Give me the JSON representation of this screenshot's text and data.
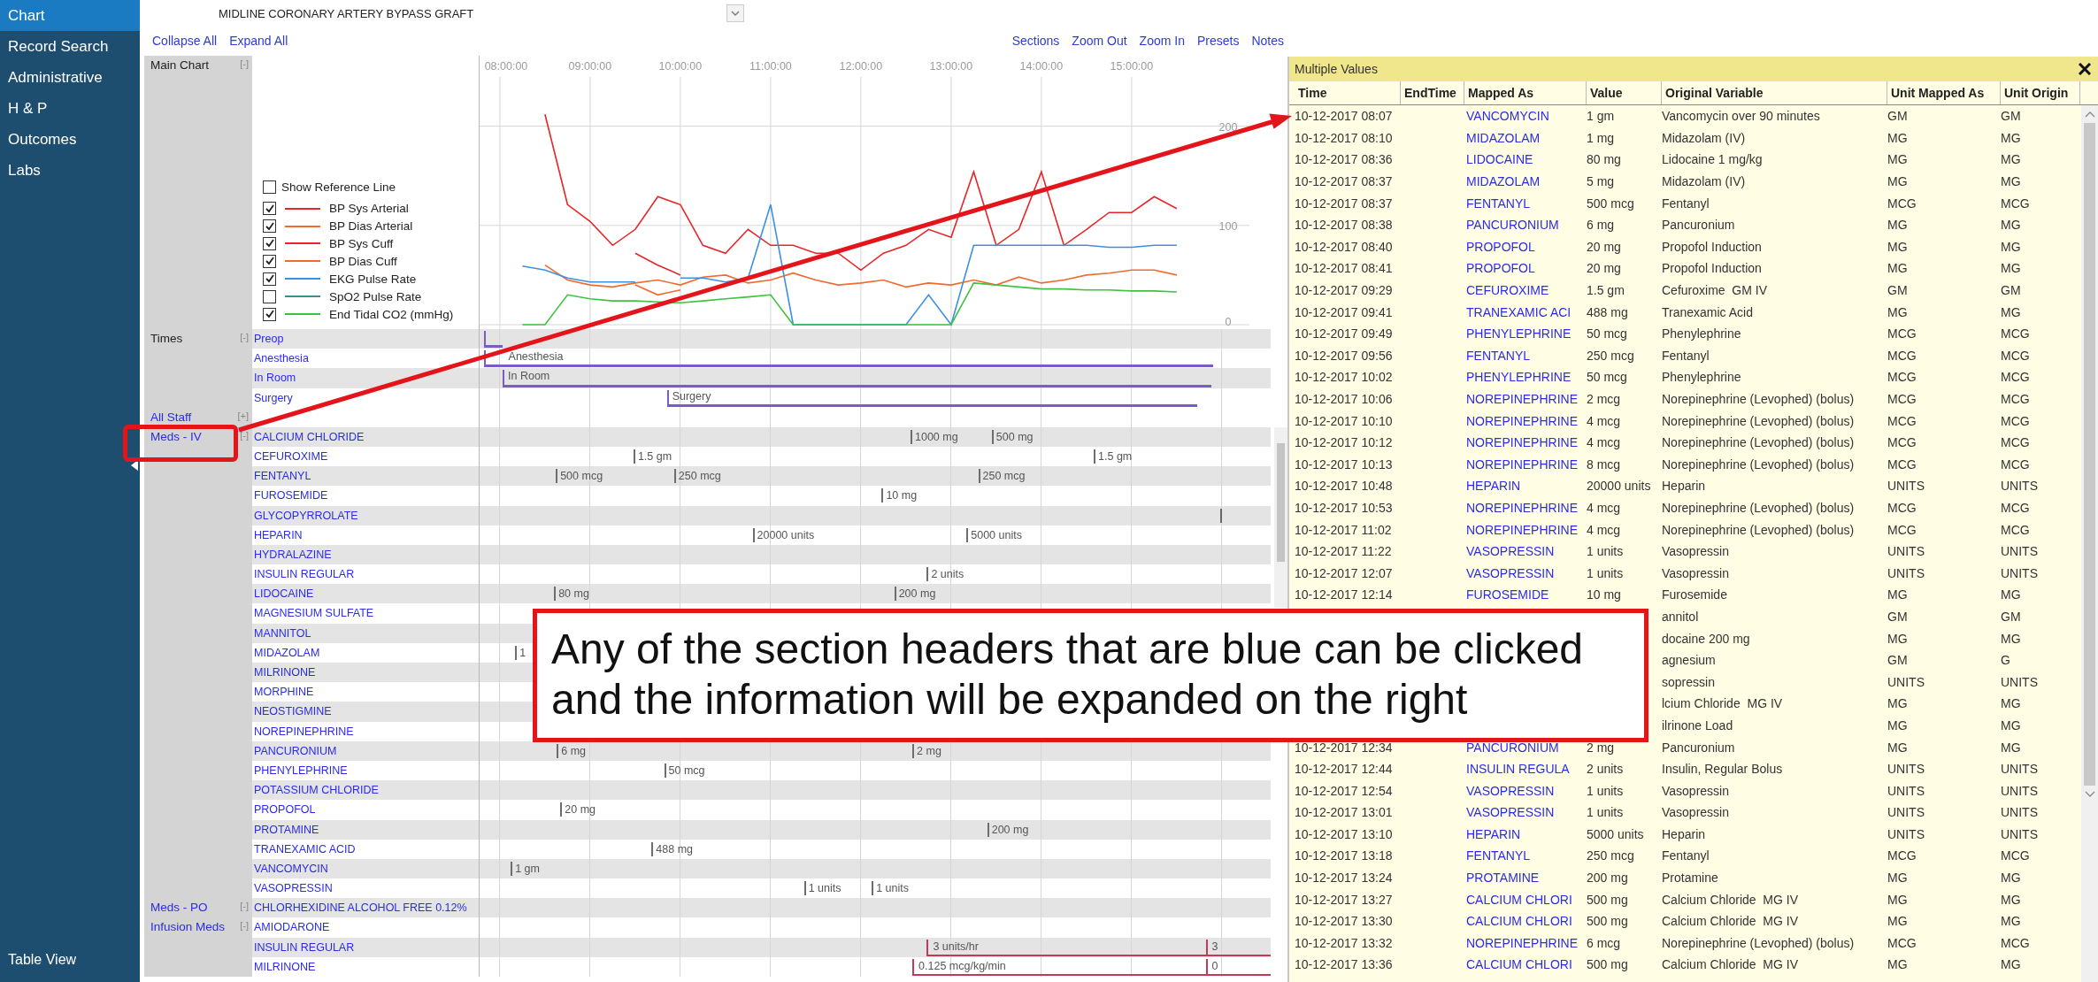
{
  "sidebar": {
    "items": [
      {
        "label": "Chart",
        "selected": true
      },
      {
        "label": "Record Search",
        "selected": false
      },
      {
        "label": "Administrative",
        "selected": false
      },
      {
        "label": "H & P",
        "selected": false
      },
      {
        "label": "Outcomes",
        "selected": false
      },
      {
        "label": "Labs",
        "selected": false
      }
    ],
    "footer": "Table View"
  },
  "procedure": "MIDLINE CORONARY ARTERY BYPASS GRAFT",
  "toolbar": {
    "left": [
      "Collapse All",
      "Expand All"
    ],
    "right": [
      "Sections",
      "Zoom Out",
      "Zoom In",
      "Presets",
      "Notes"
    ]
  },
  "main_chart": {
    "label": "Main Chart",
    "toggle": "[-]",
    "show_reference_line": {
      "label": "Show Reference Line",
      "checked": false
    },
    "legend": [
      {
        "checked": true
      },
      {
        "checked": true
      },
      {
        "checked": true
      },
      {
        "checked": true
      },
      {
        "checked": true
      },
      {
        "checked": false
      },
      {
        "checked": true
      }
    ],
    "chart_data": {
      "type": "line",
      "grid": true,
      "xlim": [
        7.775,
        16.55
      ],
      "ylim": [
        0,
        271
      ],
      "x": [
        8.25,
        8.5,
        8.75,
        9,
        9.25,
        9.5,
        9.75,
        10,
        10.25,
        10.5,
        10.75,
        11,
        11.25,
        11.5,
        11.75,
        12,
        12.25,
        12.5,
        12.75,
        13,
        13.25,
        13.5,
        13.75,
        14,
        14.25,
        14.5,
        14.75,
        15,
        15.25,
        15.5
      ],
      "xticks": [
        {
          "value": 8,
          "label": "08:00:00"
        },
        {
          "value": 9,
          "label": "09:00:00"
        },
        {
          "value": 10,
          "label": "10:00:00"
        },
        {
          "value": 11,
          "label": "11:00:00"
        },
        {
          "value": 12,
          "label": "12:00:00"
        },
        {
          "value": 13,
          "label": "13:00:00"
        },
        {
          "value": 14,
          "label": "14:00:00"
        },
        {
          "value": 15,
          "label": "15:00:00"
        }
      ],
      "yticks": [
        0,
        100,
        200
      ],
      "series": [
        {
          "name": "BP Sys Arterial",
          "color": "#e8262a",
          "values": [
            null,
            212,
            121,
            104,
            80,
            96,
            129,
            121,
            80,
            72,
            96,
            80,
            80,
            72,
            72,
            55,
            72,
            80,
            96,
            88,
            154,
            80,
            96,
            154,
            80,
            96,
            113,
            113,
            129,
            117
          ]
        },
        {
          "name": "BP Dias Arterial",
          "color": "#f26a2e",
          "values": [
            null,
            60,
            45,
            40,
            38,
            42,
            45,
            40,
            48,
            50,
            42,
            45,
            52,
            45,
            40,
            42,
            45,
            38,
            42,
            40,
            45,
            40,
            48,
            42,
            45,
            50,
            52,
            55,
            55,
            50
          ]
        },
        {
          "name": "BP Sys Cuff",
          "color": "#e8262a",
          "values": [
            null,
            null,
            null,
            null,
            null,
            72,
            60,
            50,
            null,
            null,
            null,
            null,
            null,
            null,
            null,
            null,
            null,
            null,
            null,
            null,
            null,
            null,
            null,
            null,
            null,
            null,
            null,
            null,
            null,
            null
          ]
        },
        {
          "name": "BP Dias Cuff",
          "color": "#f26a2e",
          "values": [
            null,
            null,
            null,
            null,
            null,
            40,
            30,
            35,
            null,
            null,
            null,
            null,
            null,
            null,
            null,
            null,
            null,
            null,
            null,
            null,
            null,
            null,
            null,
            null,
            null,
            null,
            null,
            null,
            null,
            null
          ]
        },
        {
          "name": "EKG Pulse Rate",
          "color": "#3d8fe6",
          "values": [
            59,
            55,
            47,
            43,
            43,
            43,
            null,
            47,
            47,
            43,
            47,
            121,
            0,
            0,
            0,
            0,
            0,
            0,
            30,
            0,
            80,
            80,
            80,
            80,
            80,
            80,
            78,
            78,
            80,
            80
          ]
        },
        {
          "name": "SpO2 Pulse Rate",
          "color": "#3c8f8f",
          "values": [
            null,
            null,
            null,
            null,
            null,
            null,
            null,
            null,
            null,
            null,
            null,
            null,
            null,
            null,
            null,
            null,
            null,
            null,
            null,
            null,
            null,
            null,
            null,
            null,
            null,
            null,
            null,
            null,
            null,
            null
          ]
        },
        {
          "name": "End Tidal CO2 (mmHg)",
          "color": "#3fc23f",
          "values": [
            0,
            0,
            30,
            26,
            24,
            24,
            23,
            22,
            24,
            26,
            28,
            30,
            0,
            0,
            0,
            0,
            0,
            0,
            0,
            0,
            42,
            40,
            38,
            36,
            36,
            35,
            35,
            34,
            34,
            33
          ]
        }
      ]
    }
  },
  "sections": [
    {
      "label": "Times",
      "toggle": "[-]",
      "clickable": false,
      "rows": [
        {
          "name": "Preop",
          "items": [
            {
              "kind": "bar"
            }
          ]
        },
        {
          "name": "Anesthesia",
          "items": [
            {
              "kind": "bar",
              "label": "Anesthesia"
            }
          ]
        },
        {
          "name": "In Room",
          "items": [
            {
              "kind": "bar",
              "label": "In Room"
            }
          ]
        },
        {
          "name": "Surgery",
          "items": [
            {
              "kind": "bar",
              "label": "Surgery"
            }
          ]
        }
      ]
    },
    {
      "label": "All Staff",
      "toggle": "[+]",
      "clickable": true
    },
    {
      "label": "Meds - IV",
      "toggle": "[-]",
      "clickable": true,
      "rows": [
        {
          "name": "CALCIUM CHLORIDE",
          "items": [
            {
              "kind": "dose",
              "label": "1000 mg"
            },
            {
              "kind": "dose",
              "label": "500 mg"
            }
          ]
        },
        {
          "name": "CEFUROXIME",
          "items": [
            {
              "kind": "dose",
              "label": "1.5 gm"
            },
            {
              "kind": "dose",
              "label": "1.5 gm"
            }
          ]
        },
        {
          "name": "FENTANYL",
          "items": [
            {
              "kind": "dose",
              "label": "500 mcg"
            },
            {
              "kind": "dose",
              "label": "250 mcg"
            },
            {
              "kind": "dose",
              "label": "250 mcg"
            }
          ]
        },
        {
          "name": "FUROSEMIDE",
          "items": [
            {
              "kind": "dose",
              "label": "10 mg"
            }
          ]
        },
        {
          "name": "GLYCOPYRROLATE",
          "items": [
            {
              "kind": "tick"
            }
          ]
        },
        {
          "name": "HEPARIN",
          "items": [
            {
              "kind": "dose",
              "label": "20000 units"
            },
            {
              "kind": "dose",
              "label": "5000 units"
            }
          ]
        },
        {
          "name": "HYDRALAZINE"
        },
        {
          "name": "INSULIN REGULAR",
          "items": [
            {
              "kind": "dose",
              "label": "2 units"
            }
          ]
        },
        {
          "name": "LIDOCAINE",
          "items": [
            {
              "kind": "dose",
              "label": "80 mg"
            },
            {
              "kind": "dose",
              "label": "200 mg"
            }
          ]
        },
        {
          "name": "MAGNESIUM SULFATE"
        },
        {
          "name": "MANNITOL"
        },
        {
          "name": "MIDAZOLAM",
          "items": [
            {
              "kind": "dose",
              "label": "1"
            }
          ]
        },
        {
          "name": "MILRINONE"
        },
        {
          "name": "MORPHINE"
        },
        {
          "name": "NEOSTIGMINE"
        },
        {
          "name": "NOREPINEPHRINE"
        },
        {
          "name": "PANCURONIUM",
          "items": [
            {
              "kind": "dose",
              "label": "6 mg"
            },
            {
              "kind": "dose",
              "label": "2 mg"
            }
          ]
        },
        {
          "name": "PHENYLEPHRINE",
          "items": [
            {
              "kind": "dose",
              "label": "50 mcg"
            }
          ]
        },
        {
          "name": "POTASSIUM CHLORIDE"
        },
        {
          "name": "PROPOFOL",
          "items": [
            {
              "kind": "dose",
              "label": "20 mg"
            }
          ]
        },
        {
          "name": "PROTAMINE",
          "items": [
            {
              "kind": "dose",
              "label": "200 mg"
            }
          ]
        },
        {
          "name": "TRANEXAMIC ACID",
          "items": [
            {
              "kind": "dose",
              "label": "488 mg"
            }
          ]
        },
        {
          "name": "VANCOMYCIN",
          "items": [
            {
              "kind": "dose",
              "label": "1 gm"
            }
          ]
        },
        {
          "name": "VASOPRESSIN",
          "items": [
            {
              "kind": "dose",
              "label": "1 units"
            },
            {
              "kind": "dose",
              "label": "1 units"
            }
          ]
        }
      ]
    },
    {
      "label": "Meds - PO",
      "toggle": "[-]",
      "clickable": true,
      "rows": [
        {
          "name": "CHLORHEXIDINE ALCOHOL FREE 0.12%"
        }
      ]
    },
    {
      "label": "Infusion Meds",
      "toggle": "[-]",
      "clickable": true,
      "rows": [
        {
          "name": "AMIODARONE"
        },
        {
          "name": "INSULIN REGULAR",
          "items": [
            {
              "kind": "infusion",
              "label": "3 units/hr"
            },
            {
              "kind": "infusion",
              "label": "3"
            }
          ]
        },
        {
          "name": "MILRINONE",
          "items": [
            {
              "kind": "infusion",
              "label": "0.125 mcg/kg/min"
            },
            {
              "kind": "infusion",
              "label": "0"
            }
          ]
        }
      ]
    }
  ],
  "multiple_values": {
    "title": "Multiple Values",
    "columns": [
      "Time",
      "EndTime",
      "Mapped As",
      "Value",
      "Original Variable",
      "Unit Mapped As",
      "Unit Origin"
    ],
    "rows": [
      {
        "time": "10-12-2017 08:07",
        "mapped_as": "VANCOMYCIN",
        "value": "1 gm",
        "original_variable": "Vancomycin over 90 minutes",
        "unit_mapped_as": "GM",
        "unit_origin": "GM"
      },
      {
        "time": "10-12-2017 08:10",
        "mapped_as": "MIDAZOLAM",
        "value": "1 mg",
        "original_variable": "Midazolam (IV)",
        "unit_mapped_as": "MG",
        "unit_origin": "MG"
      },
      {
        "time": "10-12-2017 08:36",
        "mapped_as": "LIDOCAINE",
        "value": "80 mg",
        "original_variable": "Lidocaine 1 mg/kg",
        "unit_mapped_as": "MG",
        "unit_origin": "MG"
      },
      {
        "time": "10-12-2017 08:37",
        "mapped_as": "MIDAZOLAM",
        "value": "5 mg",
        "original_variable": "Midazolam (IV)",
        "unit_mapped_as": "MG",
        "unit_origin": "MG"
      },
      {
        "time": "10-12-2017 08:37",
        "mapped_as": "FENTANYL",
        "value": "500 mcg",
        "original_variable": "Fentanyl",
        "unit_mapped_as": "MCG",
        "unit_origin": "MCG"
      },
      {
        "time": "10-12-2017 08:38",
        "mapped_as": "PANCURONIUM",
        "value": "6 mg",
        "original_variable": "Pancuronium",
        "unit_mapped_as": "MG",
        "unit_origin": "MG"
      },
      {
        "time": "10-12-2017 08:40",
        "mapped_as": "PROPOFOL",
        "value": "20 mg",
        "original_variable": "Propofol Induction",
        "unit_mapped_as": "MG",
        "unit_origin": "MG"
      },
      {
        "time": "10-12-2017 08:41",
        "mapped_as": "PROPOFOL",
        "value": "20 mg",
        "original_variable": "Propofol Induction",
        "unit_mapped_as": "MG",
        "unit_origin": "MG"
      },
      {
        "time": "10-12-2017 09:29",
        "mapped_as": "CEFUROXIME",
        "value": "1.5 gm",
        "original_variable": "Cefuroxime  GM IV",
        "unit_mapped_as": "GM",
        "unit_origin": "GM"
      },
      {
        "time": "10-12-2017 09:41",
        "mapped_as": "TRANEXAMIC ACI",
        "value": "488 mg",
        "original_variable": "Tranexamic Acid",
        "unit_mapped_as": "MG",
        "unit_origin": "MG"
      },
      {
        "time": "10-12-2017 09:49",
        "mapped_as": "PHENYLEPHRINE",
        "value": "50 mcg",
        "original_variable": "Phenylephrine",
        "unit_mapped_as": "MCG",
        "unit_origin": "MCG"
      },
      {
        "time": "10-12-2017 09:56",
        "mapped_as": "FENTANYL",
        "value": "250 mcg",
        "original_variable": "Fentanyl",
        "unit_mapped_as": "MCG",
        "unit_origin": "MCG"
      },
      {
        "time": "10-12-2017 10:02",
        "mapped_as": "PHENYLEPHRINE",
        "value": "50 mcg",
        "original_variable": "Phenylephrine",
        "unit_mapped_as": "MCG",
        "unit_origin": "MCG"
      },
      {
        "time": "10-12-2017 10:06",
        "mapped_as": "NOREPINEPHRINE",
        "value": "2 mcg",
        "original_variable": "Norepinephrine (Levophed) (bolus)",
        "unit_mapped_as": "MCG",
        "unit_origin": "MCG"
      },
      {
        "time": "10-12-2017 10:10",
        "mapped_as": "NOREPINEPHRINE",
        "value": "4 mcg",
        "original_variable": "Norepinephrine (Levophed) (bolus)",
        "unit_mapped_as": "MCG",
        "unit_origin": "MCG"
      },
      {
        "time": "10-12-2017 10:12",
        "mapped_as": "NOREPINEPHRINE",
        "value": "4 mcg",
        "original_variable": "Norepinephrine (Levophed) (bolus)",
        "unit_mapped_as": "MCG",
        "unit_origin": "MCG"
      },
      {
        "time": "10-12-2017 10:13",
        "mapped_as": "NOREPINEPHRINE",
        "value": "8 mcg",
        "original_variable": "Norepinephrine (Levophed) (bolus)",
        "unit_mapped_as": "MCG",
        "unit_origin": "MCG"
      },
      {
        "time": "10-12-2017 10:48",
        "mapped_as": "HEPARIN",
        "value": "20000 units",
        "original_variable": "Heparin",
        "unit_mapped_as": "UNITS",
        "unit_origin": "UNITS"
      },
      {
        "time": "10-12-2017 10:53",
        "mapped_as": "NOREPINEPHRINE",
        "value": "4 mcg",
        "original_variable": "Norepinephrine (Levophed) (bolus)",
        "unit_mapped_as": "MCG",
        "unit_origin": "MCG"
      },
      {
        "time": "10-12-2017 11:02",
        "mapped_as": "NOREPINEPHRINE",
        "value": "4 mcg",
        "original_variable": "Norepinephrine (Levophed) (bolus)",
        "unit_mapped_as": "MCG",
        "unit_origin": "MCG"
      },
      {
        "time": "10-12-2017 11:22",
        "mapped_as": "VASOPRESSIN",
        "value": "1 units",
        "original_variable": "Vasopressin",
        "unit_mapped_as": "UNITS",
        "unit_origin": "UNITS"
      },
      {
        "time": "10-12-2017 12:07",
        "mapped_as": "VASOPRESSIN",
        "value": "1 units",
        "original_variable": "Vasopressin",
        "unit_mapped_as": "UNITS",
        "unit_origin": "UNITS"
      },
      {
        "time": "10-12-2017 12:14",
        "mapped_as": "FUROSEMIDE",
        "value": "10 mg",
        "original_variable": "Furosemide",
        "unit_mapped_as": "MG",
        "unit_origin": "MG"
      },
      {
        "original_variable": "annitol",
        "unit_mapped_as": "GM",
        "unit_origin": "GM"
      },
      {
        "original_variable": "docaine 200 mg",
        "unit_mapped_as": "MG",
        "unit_origin": "MG"
      },
      {
        "original_variable": "agnesium",
        "unit_mapped_as": "GM",
        "unit_origin": "G"
      },
      {
        "original_variable": "sopressin",
        "unit_mapped_as": "UNITS",
        "unit_origin": "UNITS"
      },
      {
        "original_variable": "lcium Chloride  MG IV",
        "unit_mapped_as": "MG",
        "unit_origin": "MG"
      },
      {
        "original_variable": "ilrinone Load",
        "unit_mapped_as": "MG",
        "unit_origin": "MG"
      },
      {
        "time": "10-12-2017 12:34",
        "mapped_as": "PANCURONIUM",
        "value": "2 mg",
        "original_variable": "Pancuronium",
        "unit_mapped_as": "MG",
        "unit_origin": "MG"
      },
      {
        "time": "10-12-2017 12:44",
        "mapped_as": "INSULIN REGULA",
        "value": "2 units",
        "original_variable": "Insulin, Regular Bolus",
        "unit_mapped_as": "UNITS",
        "unit_origin": "UNITS"
      },
      {
        "time": "10-12-2017 12:54",
        "mapped_as": "VASOPRESSIN",
        "value": "1 units",
        "original_variable": "Vasopressin",
        "unit_mapped_as": "UNITS",
        "unit_origin": "UNITS"
      },
      {
        "time": "10-12-2017 13:01",
        "mapped_as": "VASOPRESSIN",
        "value": "1 units",
        "original_variable": "Vasopressin",
        "unit_mapped_as": "UNITS",
        "unit_origin": "UNITS"
      },
      {
        "time": "10-12-2017 13:10",
        "mapped_as": "HEPARIN",
        "value": "5000 units",
        "original_variable": "Heparin",
        "unit_mapped_as": "UNITS",
        "unit_origin": "UNITS"
      },
      {
        "time": "10-12-2017 13:18",
        "mapped_as": "FENTANYL",
        "value": "250 mcg",
        "original_variable": "Fentanyl",
        "unit_mapped_as": "MCG",
        "unit_origin": "MCG"
      },
      {
        "time": "10-12-2017 13:24",
        "mapped_as": "PROTAMINE",
        "value": "200 mg",
        "original_variable": "Protamine",
        "unit_mapped_as": "MG",
        "unit_origin": "MG"
      },
      {
        "time": "10-12-2017 13:27",
        "mapped_as": "CALCIUM CHLORI",
        "value": "500 mg",
        "original_variable": "Calcium Chloride  MG IV",
        "unit_mapped_as": "MG",
        "unit_origin": "MG"
      },
      {
        "time": "10-12-2017 13:30",
        "mapped_as": "CALCIUM CHLORI",
        "value": "500 mg",
        "original_variable": "Calcium Chloride  MG IV",
        "unit_mapped_as": "MG",
        "unit_origin": "MG"
      },
      {
        "time": "10-12-2017 13:32",
        "mapped_as": "NOREPINEPHRINE",
        "value": "6 mcg",
        "original_variable": "Norepinephrine (Levophed) (bolus)",
        "unit_mapped_as": "MCG",
        "unit_origin": "MCG"
      },
      {
        "time": "10-12-2017 13:36",
        "mapped_as": "CALCIUM CHLORI",
        "value": "500 mg",
        "original_variable": "Calcium Chloride  MG IV",
        "unit_mapped_as": "MG",
        "unit_origin": "MG"
      }
    ]
  },
  "annotation": {
    "callout": "Any of the section headers that are blue can be clicked\nand the information will be expanded on the right"
  }
}
